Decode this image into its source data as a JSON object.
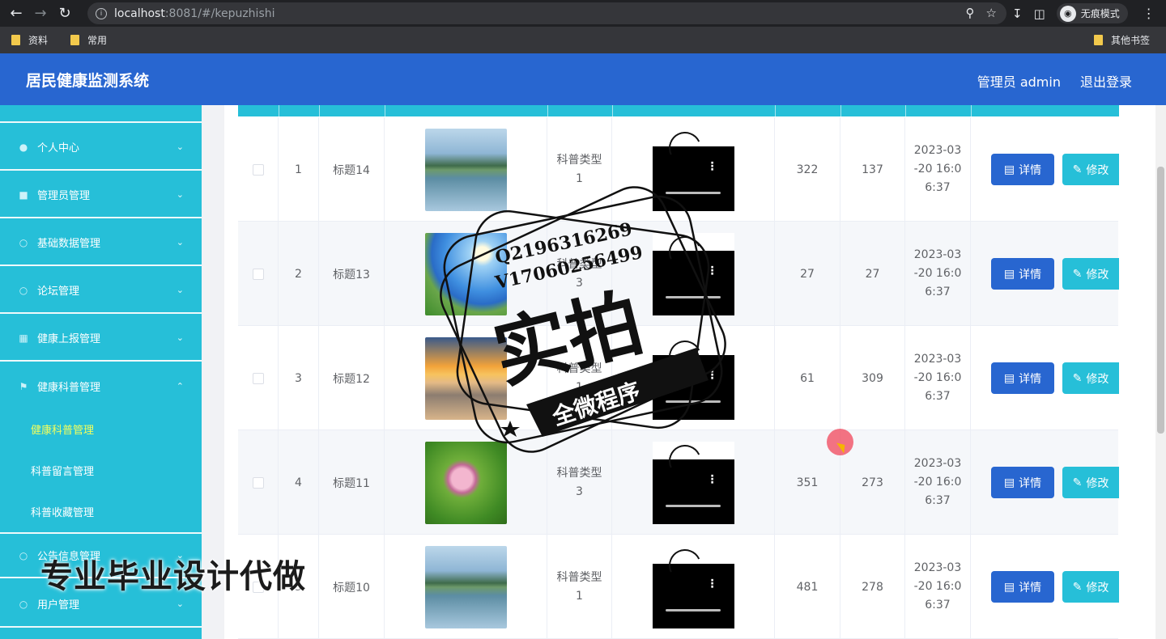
{
  "browser": {
    "url_host": "localhost",
    "url_rest": ":8081/#/kepuzhishi",
    "incognito_label": "无痕模式",
    "bookmarks": [
      "资料",
      "常用"
    ],
    "bookmarks_right": "其他书签"
  },
  "header": {
    "title": "居民健康监测系统",
    "user": "管理员 admin",
    "logout": "退出登录"
  },
  "sidebar": {
    "items": [
      {
        "label": "个人中心",
        "icon": "user-icon"
      },
      {
        "label": "管理员管理",
        "icon": "admin-icon"
      },
      {
        "label": "基础数据管理",
        "icon": "data-icon"
      },
      {
        "label": "论坛管理",
        "icon": "forum-icon"
      },
      {
        "label": "健康上报管理",
        "icon": "report-icon"
      },
      {
        "label": "健康科普管理",
        "icon": "flag-icon"
      },
      {
        "label": "公告信息管理",
        "icon": "notice-icon"
      },
      {
        "label": "用户管理",
        "icon": "users-icon"
      }
    ],
    "sub_items": [
      "健康科普管理",
      "科普留言管理",
      "科普收藏管理"
    ],
    "active_sub": "健康科普管理"
  },
  "table": {
    "rows": [
      {
        "index": "1",
        "title": "标题14",
        "type_a": "科普类型",
        "type_b": "1",
        "v1": "322",
        "v2": "137",
        "date_a": "2023-03",
        "date_b": "-20 16:0",
        "date_c": "6:37",
        "image": "mountain"
      },
      {
        "index": "2",
        "title": "标题13",
        "type_a": "科普类型",
        "type_b": "3",
        "v1": "27",
        "v2": "27",
        "date_a": "2023-03",
        "date_b": "-20 16:0",
        "date_c": "6:37",
        "image": "sky"
      },
      {
        "index": "3",
        "title": "标题12",
        "type_a": "科普类型",
        "type_b": "1",
        "v1": "61",
        "v2": "309",
        "date_a": "2023-03",
        "date_b": "-20 16:0",
        "date_c": "6:37",
        "image": "desert"
      },
      {
        "index": "4",
        "title": "标题11",
        "type_a": "科普类型",
        "type_b": "3",
        "v1": "351",
        "v2": "273",
        "date_a": "2023-03",
        "date_b": "-20 16:0",
        "date_c": "6:37",
        "image": "lotus"
      },
      {
        "index": "5",
        "title": "标题10",
        "type_a": "科普类型",
        "type_b": "1",
        "v1": "481",
        "v2": "278",
        "date_a": "2023-03",
        "date_b": "-20 16:0",
        "date_c": "6:37",
        "image": "mountain"
      }
    ],
    "detail_label": "详情",
    "edit_label": "修改"
  },
  "watermark": {
    "line1": "Q2196316269",
    "line2": "V17060256499",
    "big": "实拍",
    "banner": "全微程序",
    "bottom": "专业毕业设计代做"
  },
  "colors": {
    "header": "#2866d0",
    "sidebar": "#26bfd8",
    "active": "#f3ff5c"
  }
}
